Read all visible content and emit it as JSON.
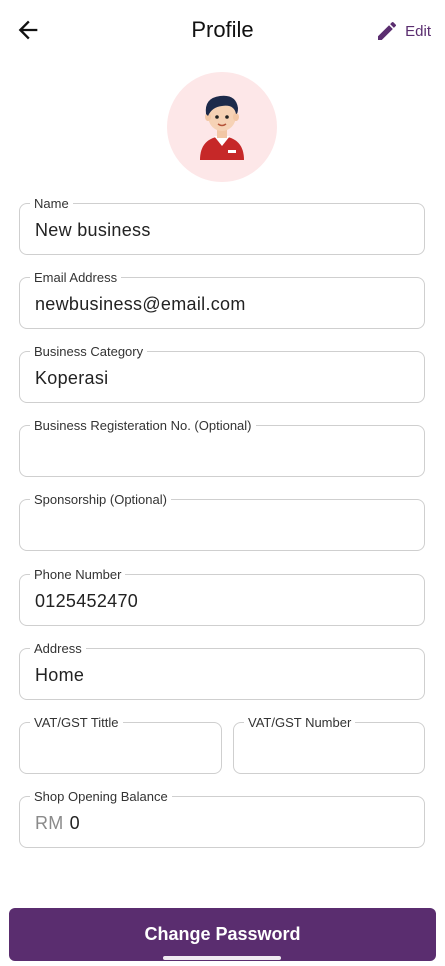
{
  "header": {
    "title": "Profile",
    "edit_label": "Edit",
    "back_icon": "arrow-left-icon",
    "edit_icon": "pencil-icon"
  },
  "avatar": {
    "icon": "user-avatar-icon"
  },
  "form": {
    "name": {
      "label": "Name",
      "value": "New business"
    },
    "email": {
      "label": "Email Address",
      "value": "newbusiness@email.com"
    },
    "category": {
      "label": "Business Category",
      "value": "Koperasi"
    },
    "registration": {
      "label": "Business Registeration No. (Optional)",
      "value": ""
    },
    "sponsorship": {
      "label": "Sponsorship (Optional)",
      "value": ""
    },
    "phone": {
      "label": "Phone Number",
      "value": "0125452470"
    },
    "address": {
      "label": "Address",
      "value": "Home"
    },
    "vat_title": {
      "label": "VAT/GST Tittle",
      "value": ""
    },
    "vat_number": {
      "label": "VAT/GST Number",
      "value": ""
    },
    "opening_balance": {
      "label": "Shop Opening Balance",
      "prefix": "RM",
      "value": "0"
    }
  },
  "actions": {
    "change_password_label": "Change Password"
  },
  "colors": {
    "accent": "#5a2d6f",
    "avatar_bg": "#fde7e8",
    "border": "#cfcfcf"
  }
}
